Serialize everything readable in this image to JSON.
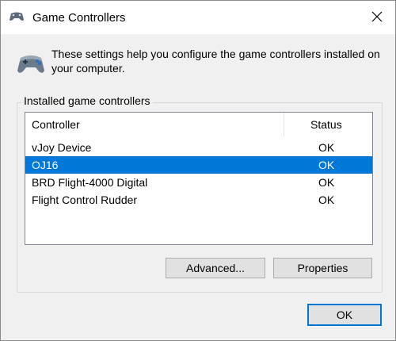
{
  "window": {
    "title": "Game Controllers",
    "icon": "gamepad-icon",
    "close_icon": "close-icon"
  },
  "info": {
    "icon": "gamepad-icon",
    "text": "These settings help you configure the game controllers installed on your computer."
  },
  "group": {
    "label": "Installed game controllers"
  },
  "list": {
    "columns": [
      "Controller",
      "Status"
    ],
    "rows": [
      {
        "controller": "vJoy Device",
        "status": "OK",
        "selected": false
      },
      {
        "controller": "OJ16",
        "status": "OK",
        "selected": true
      },
      {
        "controller": "BRD Flight-4000 Digital",
        "status": "OK",
        "selected": false
      },
      {
        "controller": "Flight Control Rudder",
        "status": "OK",
        "selected": false
      }
    ]
  },
  "buttons": {
    "advanced": "Advanced...",
    "properties": "Properties",
    "ok": "OK"
  },
  "colors": {
    "selection": "#0078d7",
    "dialog_bg": "#f0f0f0",
    "button_bg": "#e1e1e1"
  }
}
